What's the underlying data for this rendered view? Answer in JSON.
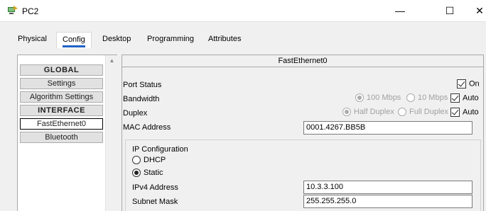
{
  "window": {
    "title": "PC2",
    "minimize_glyph": "—",
    "maximize_glyph": "☐",
    "close_glyph": "✕"
  },
  "tabs": [
    {
      "label": "Physical"
    },
    {
      "label": "Config"
    },
    {
      "label": "Desktop"
    },
    {
      "label": "Programming"
    },
    {
      "label": "Attributes"
    }
  ],
  "active_tab": "Config",
  "sidebar": {
    "items": [
      {
        "label": "GLOBAL",
        "type": "header"
      },
      {
        "label": "Settings",
        "type": "item"
      },
      {
        "label": "Algorithm Settings",
        "type": "item"
      },
      {
        "label": "INTERFACE",
        "type": "header"
      },
      {
        "label": "FastEthernet0",
        "type": "item",
        "selected": true
      },
      {
        "label": "Bluetooth",
        "type": "item"
      }
    ]
  },
  "panel": {
    "title": "FastEthernet0",
    "port_status": {
      "label": "Port Status",
      "on_label": "On",
      "on_checked": true
    },
    "bandwidth": {
      "label": "Bandwidth",
      "options": [
        "100 Mbps",
        "10 Mbps"
      ],
      "auto_label": "Auto",
      "auto_checked": true
    },
    "duplex": {
      "label": "Duplex",
      "options": [
        "Half Duplex",
        "Full Duplex"
      ],
      "auto_label": "Auto",
      "auto_checked": true
    },
    "mac": {
      "label": "MAC Address",
      "value": "0001.4267.BB5B"
    },
    "ip_config": {
      "label": "IP Configuration",
      "dhcp_label": "DHCP",
      "static_label": "Static",
      "selected": "Static",
      "ipv4": {
        "label": "IPv4 Address",
        "value": "10.3.3.100"
      },
      "subnet": {
        "label": "Subnet Mask",
        "value": "255.255.255.0"
      }
    }
  },
  "colors": {
    "active_tab_underline": "#1f63c6",
    "background": "#f0f0f0"
  }
}
